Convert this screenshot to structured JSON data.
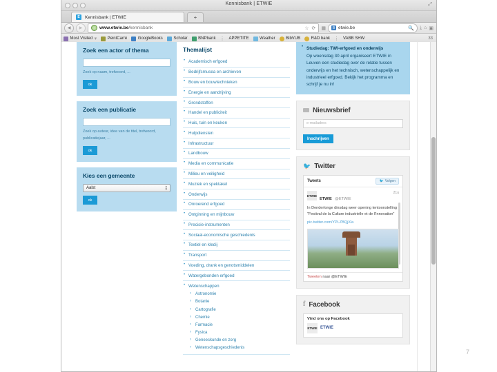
{
  "window": {
    "title": "Kennisbank | ETWIE",
    "restore_icon": "restore-icon"
  },
  "tabs": [
    {
      "label": "Kennisbank | ETWIE",
      "favicon": "E"
    }
  ],
  "newtab_label": "+",
  "toolbar": {
    "back_icon": "◀",
    "forward_icon": "▶",
    "url_prefix": "www.etwie.be",
    "url_suffix": "/kennisbank",
    "star_icon": "☆",
    "reload_icon": "⟳",
    "reader_icon": "▦",
    "search_engine": "B",
    "search_value": "etwie.be",
    "search_icon": "🔍",
    "download_icon": "⤓",
    "home_icon": "⌂",
    "apps_icon": "▣"
  },
  "bookmarks": [
    {
      "label": "Most Visited",
      "color": "#8a6fb0",
      "dropdown": true
    },
    {
      "label": "PeintCarré",
      "color": "#9a9a3c"
    },
    {
      "label": "GoogleBooks",
      "color": "#3c7fc4"
    },
    {
      "label": "Scholar",
      "color": "#5aa8d8"
    },
    {
      "label": "BNPbank",
      "color": "#3f9e6e"
    },
    {
      "label": "APPETITE",
      "color": ""
    },
    {
      "label": "Weather",
      "color": "#6fb8e0"
    },
    {
      "label": "BibVUB",
      "color": "#d8b23a"
    },
    {
      "label": "R&D bank",
      "color": "#d8b23a"
    },
    {
      "label": "VABB SHW",
      "color": ""
    }
  ],
  "bookmarks_overflow": "33",
  "left_column": {
    "actor_box": {
      "title": "Zoek een actor of thema",
      "input_value": "",
      "hint": "Zoek op naam, trefwoord, ...",
      "button": "ok"
    },
    "publication_box": {
      "title": "Zoek een publicatie",
      "input_value": "",
      "hint": "Zoek op auteur, idee van de titel, trefwoord, publicatiejaar, ...",
      "button": "ok"
    },
    "municipality_box": {
      "title": "Kies een gemeente",
      "select_value": "Aalst",
      "button": "ok"
    }
  },
  "middle_column": {
    "title": "Themalijst",
    "items": [
      "Academisch erfgoed",
      "Bedrijfsmusea en archieven",
      "Bouw en bouwtechnieken",
      "Energie en aandrijving",
      "Grondstoffen",
      "Handel en publiciteit",
      "Huis, tuin en keuken",
      "Hulpdiensten",
      "Infrastructuur",
      "Landbouw",
      "Media en communicatie",
      "Milieu en veiligheid",
      "Muziek en spektakel",
      "Onderwijs",
      "Onroerend erfgoed",
      "Ontginning en mijnbouw",
      "Precisie-instrumenten",
      "Sociaal-economische geschiedenis",
      "Textiel en kledij",
      "Transport",
      "Voeding, drank en genotsmiddelen",
      "Watergebonden erfgoed",
      "Wetenschappen"
    ],
    "wetenschappen_sub": [
      "Astronomie",
      "Botanie",
      "Cartografie",
      "Chemie",
      "Farmacie",
      "Fysica",
      "Geneeskunde en zorg",
      "Wetenschapsgeschiedenis"
    ]
  },
  "right_column": {
    "news": {
      "headline": "Studiedag: TWI-erfgoed en onderwijs",
      "body": "Op woensdag 30 april organiseert ETWIE in Leuven een studiedag over de relatie tussen onderwijs en het technisch, wetenschappelijk en industrieel erfgoed. Bekijk het programma en schrijf je nu in!"
    },
    "newsletter": {
      "title": "Nieuwsbrief",
      "icon": "mail-icon",
      "placeholder": "e-mailadres",
      "value": "",
      "button": "Inschrijven"
    },
    "twitter": {
      "title": "Twitter",
      "icon": "twitter-bird-icon",
      "header_label": "Tweets",
      "follow_label": "Volgen",
      "tweet": {
        "avatar_text": "ETWIE",
        "name": "ETWIE",
        "handle": "@ETWIE",
        "time": "21u",
        "text": "In Denderlonge dinsdag weer opening tentoonstelling \"Festival de la Culture industrielle et de l'Innovation\"",
        "link": "pic.twitter.com/YPLZBQjXla",
        "photo_alt": "watertoren-photo"
      },
      "compose_prefix": "Tweeten",
      "compose_rest": " naar @ETWIE",
      "compose_full": "Tweeten naar @ETWIE"
    },
    "facebook": {
      "title": "Facebook",
      "icon": "facebook-icon",
      "header_label": "Vind ons op Facebook",
      "page_name": "ETWIE",
      "avatar_text": "ETWIE"
    }
  },
  "slide": {
    "page_number": "7"
  },
  "colors": {
    "brand_blue": "#189bd7",
    "panel_blue": "#b8dcf0",
    "news_blue": "#a9d6ee",
    "link_blue": "#2d82ae",
    "heading_blue": "#0d4a6b"
  }
}
